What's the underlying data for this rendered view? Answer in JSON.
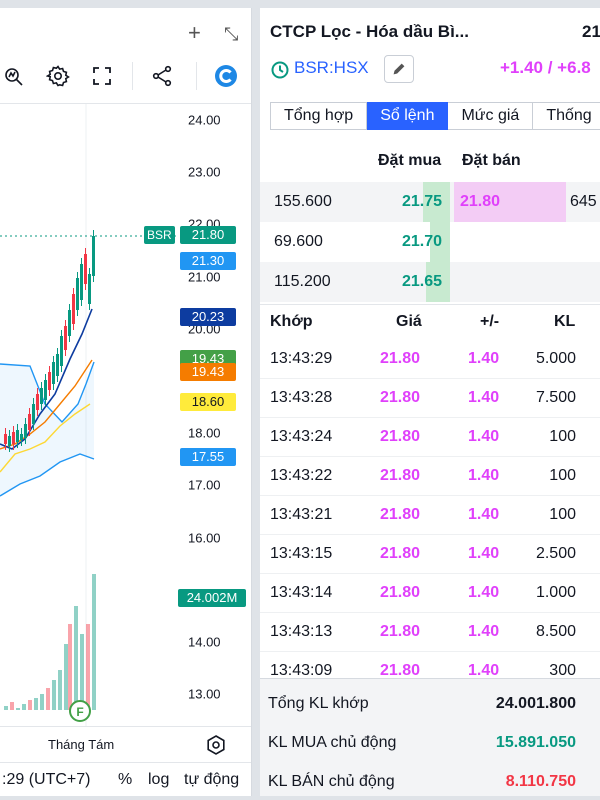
{
  "chart": {
    "window_controls": {
      "add": "+",
      "collapse": "⤡"
    },
    "toolbar": [
      "fx-icon",
      "settings-icon",
      "fullscreen-icon",
      "share-icon",
      "brand-logo"
    ],
    "price_axis_ticks": [
      {
        "label": "24.00",
        "v": 24.0
      },
      {
        "label": "23.00",
        "v": 23.0
      },
      {
        "label": "22.00",
        "v": 22.0
      },
      {
        "label": "21.00",
        "v": 21.0
      },
      {
        "label": "20.00",
        "v": 20.0
      },
      {
        "label": "18.00",
        "v": 18.0
      },
      {
        "label": "17.00",
        "v": 17.0
      },
      {
        "label": "16.00",
        "v": 16.0
      },
      {
        "label": "14.00",
        "v": 14.0
      },
      {
        "label": "13.00",
        "v": 13.0
      }
    ],
    "price_tags": [
      {
        "label": "21.80",
        "v": 21.8,
        "color": "#089981",
        "symbol": "BSR"
      },
      {
        "label": "21.30",
        "v": 21.3,
        "color": "#2196f3"
      },
      {
        "label": "20.23",
        "v": 20.23,
        "color": "#0d3ca0"
      },
      {
        "label": "19.43",
        "v": 19.43,
        "color": "#43a047"
      },
      {
        "label": "19.43",
        "v": 19.18,
        "color": "#f57c00"
      },
      {
        "label": "18.60",
        "v": 18.6,
        "color": "#ffeb3b",
        "text_color": "#131722"
      },
      {
        "label": "17.55",
        "v": 17.55,
        "color": "#2196f3"
      }
    ],
    "volume_tag": {
      "label": "24.002M",
      "color": "#089981"
    },
    "time_axis_label": "Tháng Tám",
    "event_marker": "F",
    "footer": {
      "time": ":29 (UTC+7)",
      "percent": "%",
      "log": "log",
      "auto": "tự động"
    }
  },
  "order_book": {
    "title": "CTCP Lọc - Hóa dầu Bì...",
    "last_price": "21",
    "symbol": "BSR:HSX",
    "change": "+1.40 / +6.8",
    "tabs": [
      {
        "label": "Tổng hợp",
        "active": false
      },
      {
        "label": "Sổ lệnh",
        "active": true
      },
      {
        "label": "Mức giá",
        "active": false
      },
      {
        "label": "Thống",
        "active": false
      }
    ],
    "depth_headers": {
      "bid": "Đặt mua",
      "ask": "Đặt bán"
    },
    "depth": [
      {
        "bid_vol": "155.600",
        "bid": "21.75",
        "ask": "21.80",
        "ask_vol": "645",
        "bid_fill": 0.19,
        "ask_fill": 0.8
      },
      {
        "bid_vol": "69.600",
        "bid": "21.70",
        "ask": "",
        "ask_vol": "",
        "bid_fill": 0.14,
        "ask_fill": 0
      },
      {
        "bid_vol": "115.200",
        "bid": "21.65",
        "ask": "",
        "ask_vol": "",
        "bid_fill": 0.17,
        "ask_fill": 0
      }
    ],
    "trade_headers": {
      "time": "Khớp",
      "price": "Giá",
      "change": "+/-",
      "volume": "KL"
    },
    "trades": [
      {
        "time": "13:43:29",
        "price": "21.80",
        "change": "1.40",
        "volume": "5.000"
      },
      {
        "time": "13:43:28",
        "price": "21.80",
        "change": "1.40",
        "volume": "7.500"
      },
      {
        "time": "13:43:24",
        "price": "21.80",
        "change": "1.40",
        "volume": "100"
      },
      {
        "time": "13:43:22",
        "price": "21.80",
        "change": "1.40",
        "volume": "100"
      },
      {
        "time": "13:43:21",
        "price": "21.80",
        "change": "1.40",
        "volume": "100"
      },
      {
        "time": "13:43:15",
        "price": "21.80",
        "change": "1.40",
        "volume": "2.500"
      },
      {
        "time": "13:43:14",
        "price": "21.80",
        "change": "1.40",
        "volume": "1.000"
      },
      {
        "time": "13:43:13",
        "price": "21.80",
        "change": "1.40",
        "volume": "8.500"
      },
      {
        "time": "13:43:09",
        "price": "21.80",
        "change": "1.40",
        "volume": "300"
      }
    ],
    "summary": [
      {
        "label": "Tổng KL khớp",
        "value": "24.001.800",
        "color": "#131722"
      },
      {
        "label": "KL MUA chủ động",
        "value": "15.891.050",
        "color": "#089981"
      },
      {
        "label": "KL BÁN chủ động",
        "value": "8.110.750",
        "color": "#f23645"
      }
    ]
  }
}
